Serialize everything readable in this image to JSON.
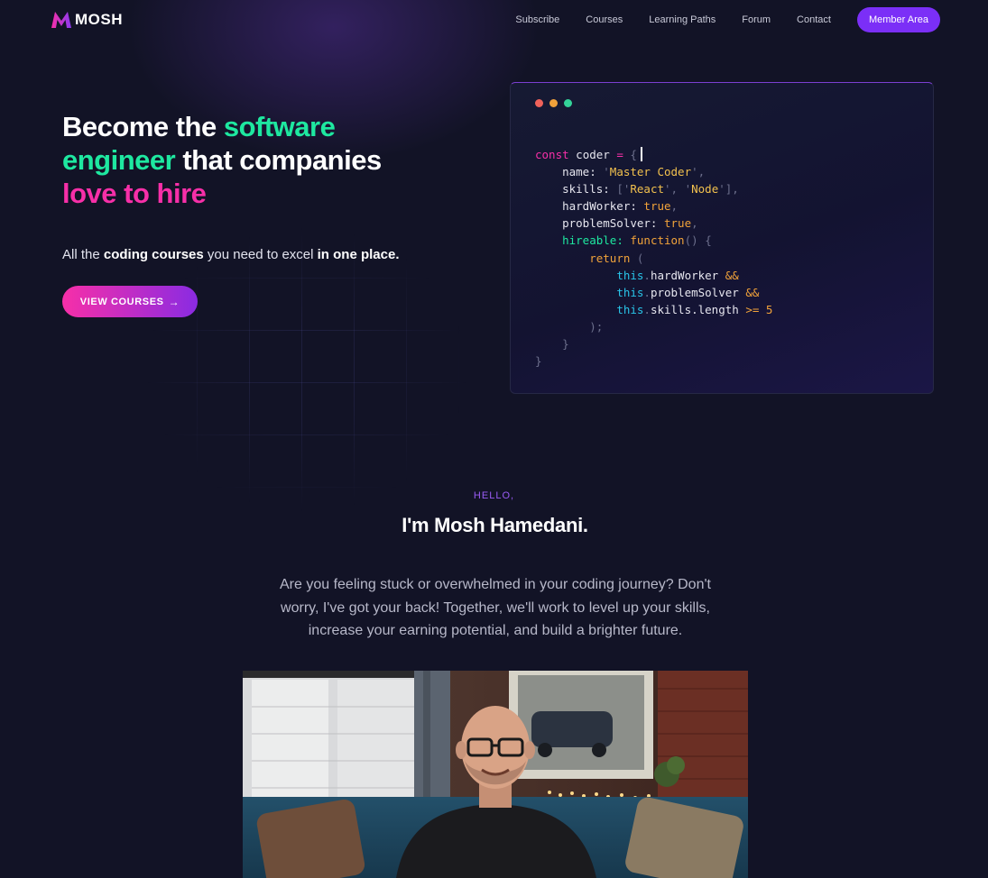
{
  "nav": {
    "logo_text": "MOSH",
    "links": [
      "Subscribe",
      "Courses",
      "Learning Paths",
      "Forum",
      "Contact"
    ],
    "member_button": "Member Area"
  },
  "hero": {
    "title_parts": [
      "Become the ",
      "software engineer",
      " that companies ",
      "love to hire"
    ],
    "subtitle_parts": [
      "All the ",
      "coding courses",
      " you need to excel ",
      "in one place."
    ],
    "cta_label": "VIEW COURSES",
    "cta_icon": "arrow-right-icon"
  },
  "code_card": {
    "dot_colors": [
      "#f0625a",
      "#f0a13b",
      "#34d399"
    ],
    "lines": [
      "const coder = {",
      "name: 'Master Coder',",
      "skills: ['React', 'Node'],",
      "hardWorker: true,",
      "problemSolver: true,",
      "hireable: function() {",
      "return (",
      "this.hardWorker &&",
      "this.problemSolver &&",
      "this.skills.length >= 5",
      ");",
      "}",
      "}"
    ]
  },
  "about": {
    "greeting": "HELLO,",
    "name": "I'm Mosh Hamedani.",
    "paragraph": "Are you feeling stuck or overwhelmed in your coding journey? Don't worry, I've got your back! Together, we'll work to level up your skills, increase your earning potential, and build a brighter future."
  },
  "colors": {
    "background": "#121326",
    "accent_purple": "#7b2ff7",
    "accent_green": "#1ee8a0",
    "accent_pink": "#f72fa8"
  }
}
